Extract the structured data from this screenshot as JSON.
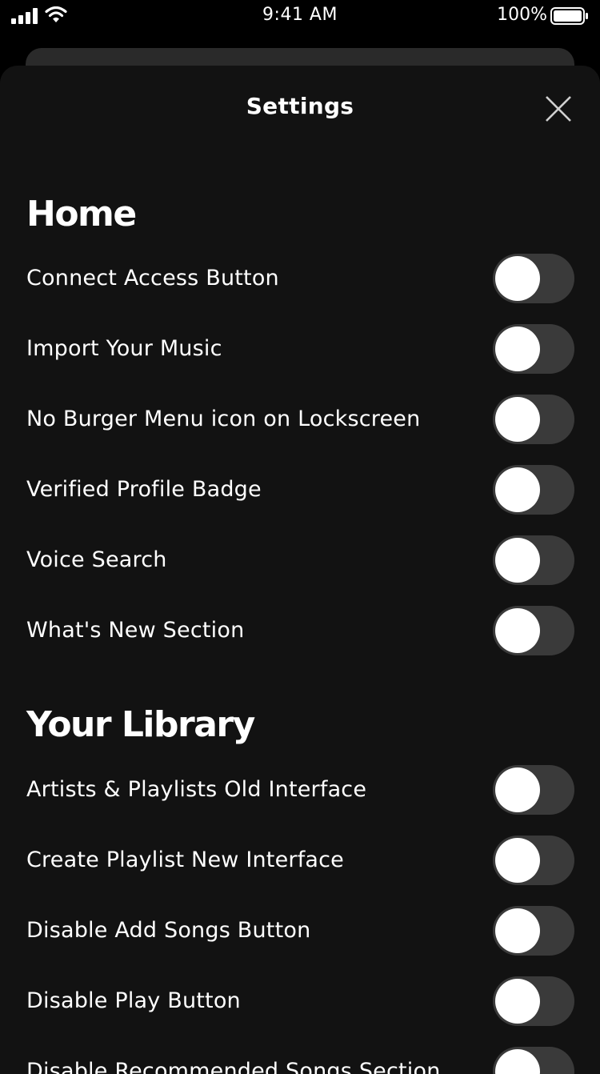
{
  "status_bar": {
    "time": "9:41 AM",
    "battery": "100%"
  },
  "sheet": {
    "title": "Settings"
  },
  "sections": [
    {
      "title": "Home",
      "items": [
        {
          "label": "Connect Access Button",
          "on": false
        },
        {
          "label": "Import Your Music",
          "on": false
        },
        {
          "label": "No Burger Menu icon on Lockscreen",
          "on": false
        },
        {
          "label": "Verified Profile Badge",
          "on": false
        },
        {
          "label": "Voice Search",
          "on": false
        },
        {
          "label": "What's New Section",
          "on": false
        }
      ]
    },
    {
      "title": "Your Library",
      "items": [
        {
          "label": "Artists & Playlists Old Interface",
          "on": false
        },
        {
          "label": "Create Playlist New Interface",
          "on": false
        },
        {
          "label": "Disable Add Songs Button",
          "on": false
        },
        {
          "label": "Disable Play Button",
          "on": false
        },
        {
          "label": "Disable Recommended Songs Section",
          "on": false
        }
      ]
    }
  ],
  "colors": {
    "sheet_background": "#121212",
    "toggle_track_off": "#3a3a3a",
    "toggle_knob": "#ffffff"
  }
}
